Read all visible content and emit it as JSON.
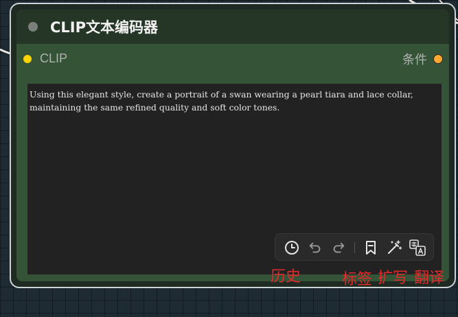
{
  "node": {
    "title": "CLIP文本编码器",
    "input_label": "CLIP",
    "output_label": "条件",
    "input_color": "#ffd500",
    "output_color": "#ffa931",
    "prompt_text": "Using this elegant style, create a portrait of a swan wearing a pearl tiara and lace collar, maintaining the same refined quality and soft color tones."
  },
  "toolbar": {
    "icons": [
      "history-icon",
      "undo-icon",
      "redo-icon",
      "bookmark-icon",
      "magic-wand-icon",
      "translate-icon"
    ]
  },
  "annotations": {
    "history": "历史",
    "tags": "标签",
    "expand": "扩写",
    "translate": "翻译"
  }
}
